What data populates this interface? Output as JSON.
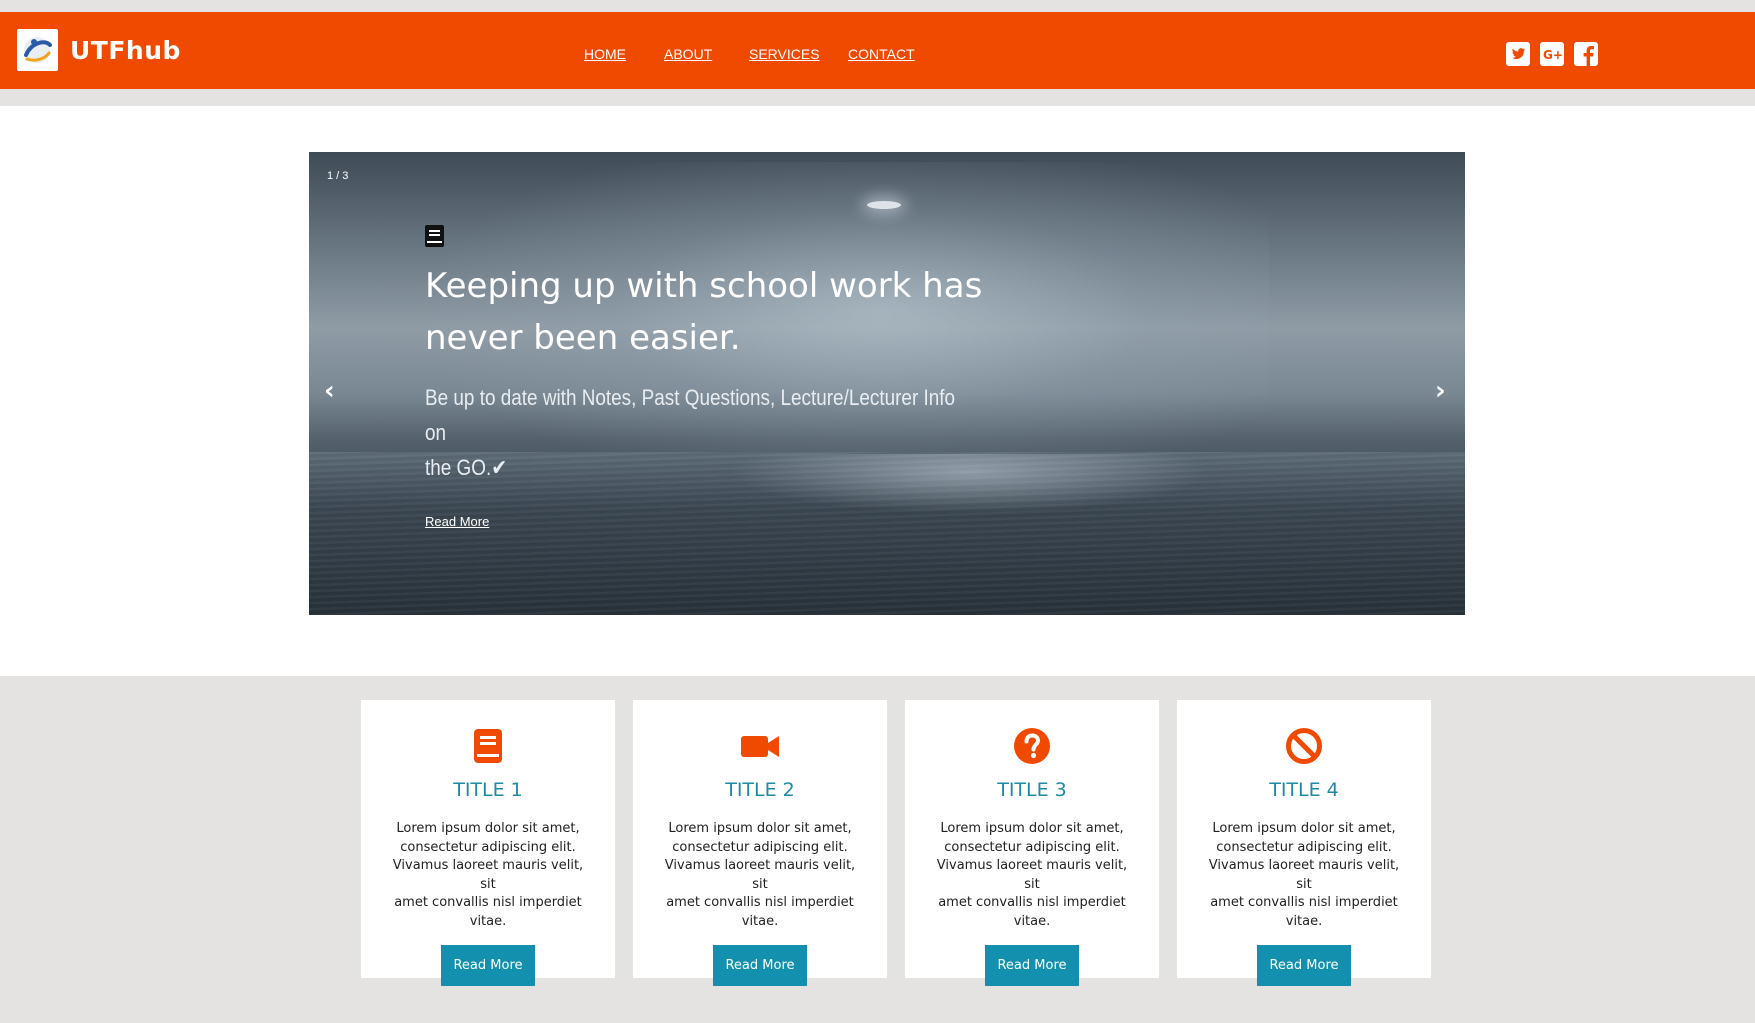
{
  "header": {
    "brand": "UTFhub",
    "nav": [
      {
        "label": "HOME"
      },
      {
        "label": "ABOUT"
      },
      {
        "label": "SERVICES"
      },
      {
        "label": "CONTACT"
      }
    ],
    "social_icons": [
      "twitter-icon",
      "google-plus-icon",
      "facebook-icon"
    ],
    "accent_color": "#f04a00"
  },
  "slider": {
    "counter": "1 / 3",
    "headline_line1": "Keeping up with school work has",
    "headline_line2": "never been easier.",
    "subline_line1": "Be up to date with Notes, Past Questions, Lecture/Lecturer Info on",
    "subline_line2": "the GO.✔",
    "read_more": "Read More",
    "prev_arrow": "‹",
    "next_arrow": "›",
    "icon": "book-icon"
  },
  "cards": [
    {
      "icon": "book-icon",
      "title": "TITLE 1",
      "lines": [
        "Lorem ipsum dolor sit amet,",
        "consectetur adipiscing elit.",
        "Vivamus laoreet mauris velit, sit",
        "amet convallis nisl imperdiet",
        "vitae."
      ],
      "button": "Read More"
    },
    {
      "icon": "video-camera-icon",
      "title": "TITLE 2",
      "lines": [
        "Lorem ipsum dolor sit amet,",
        "consectetur adipiscing elit.",
        "Vivamus laoreet mauris velit, sit",
        "amet convallis nisl imperdiet",
        "vitae."
      ],
      "button": "Read More"
    },
    {
      "icon": "question-circle-icon",
      "title": "TITLE 3",
      "lines": [
        "Lorem ipsum dolor sit amet,",
        "consectetur adipiscing elit.",
        "Vivamus laoreet mauris velit, sit",
        "amet convallis nisl imperdiet",
        "vitae."
      ],
      "button": "Read More"
    },
    {
      "icon": "ban-icon",
      "title": "TITLE 4",
      "lines": [
        "Lorem ipsum dolor sit amet,",
        "consectetur adipiscing elit.",
        "Vivamus laoreet mauris velit, sit",
        "amet convallis nisl imperdiet",
        "vitae."
      ],
      "button": "Read More"
    }
  ],
  "colors": {
    "title_teal": "#1e8aa6",
    "button_teal": "#1390ad",
    "band_gray": "#e5e3e1"
  }
}
